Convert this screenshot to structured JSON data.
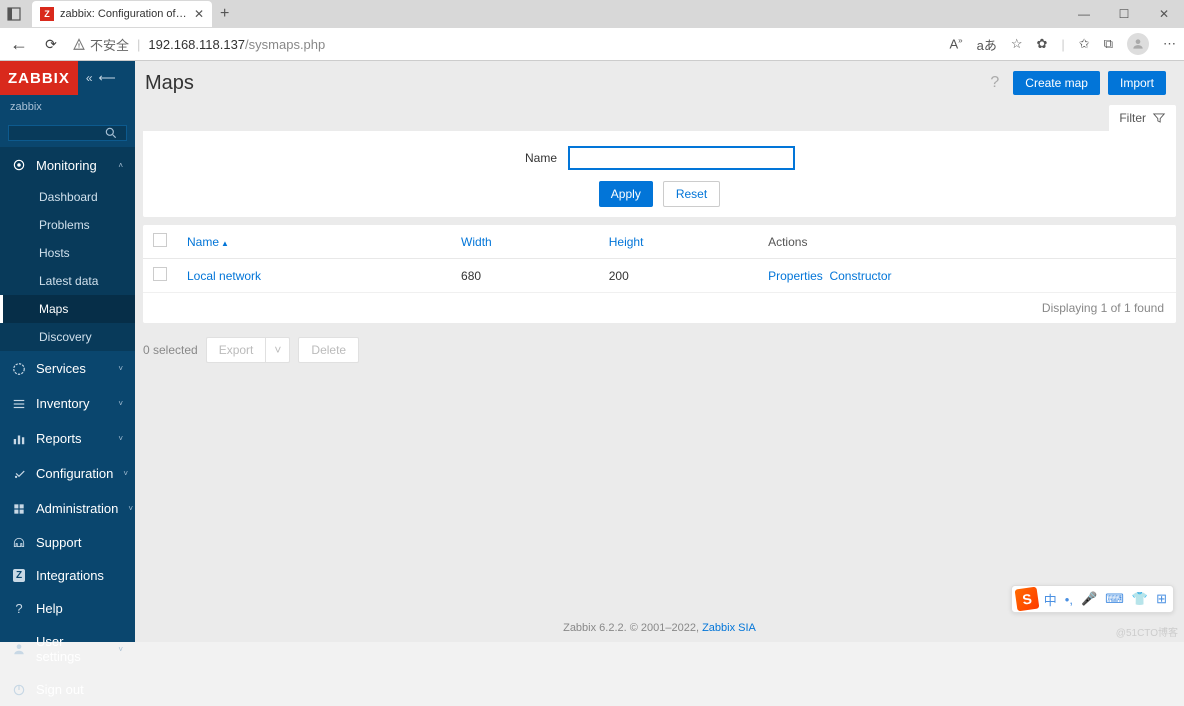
{
  "browser": {
    "tab_title": "zabbix: Configuration of network",
    "tab_favicon_letter": "Z",
    "insecure_label": "不安全",
    "url_host": "192.168.118.137",
    "url_path": "/sysmaps.php",
    "aa_icon": "A",
    "lang_icon": "aあ"
  },
  "sidebar": {
    "logo": "ZABBIX",
    "server_name": "zabbix",
    "sections": {
      "monitoring": {
        "label": "Monitoring",
        "items": [
          "Dashboard",
          "Problems",
          "Hosts",
          "Latest data",
          "Maps",
          "Discovery"
        ],
        "active_index": 4
      },
      "services": {
        "label": "Services"
      },
      "inventory": {
        "label": "Inventory"
      },
      "reports": {
        "label": "Reports"
      },
      "configuration": {
        "label": "Configuration"
      },
      "administration": {
        "label": "Administration"
      }
    },
    "footer": {
      "support": "Support",
      "integrations": "Integrations",
      "help": "Help",
      "user_settings": "User settings",
      "sign_out": "Sign out"
    }
  },
  "page": {
    "title": "Maps",
    "create_btn": "Create map",
    "import_btn": "Import",
    "filter_label": "Filter",
    "filter_name_label": "Name",
    "filter_name_value": "",
    "apply_btn": "Apply",
    "reset_btn": "Reset"
  },
  "table": {
    "columns": {
      "name": "Name",
      "width": "Width",
      "height": "Height",
      "actions": "Actions"
    },
    "rows": [
      {
        "name": "Local network",
        "width": "680",
        "height": "200",
        "action_properties": "Properties",
        "action_constructor": "Constructor"
      }
    ],
    "footer_text": "Displaying 1 of 1 found"
  },
  "bulk": {
    "selected_text": "0 selected",
    "export_btn": "Export",
    "delete_btn": "Delete"
  },
  "footer": {
    "text_prefix": "Zabbix 6.2.2. © 2001–2022, ",
    "link_text": "Zabbix SIA"
  },
  "ime": {
    "zhong": "中"
  },
  "watermark": "@51CTO博客"
}
